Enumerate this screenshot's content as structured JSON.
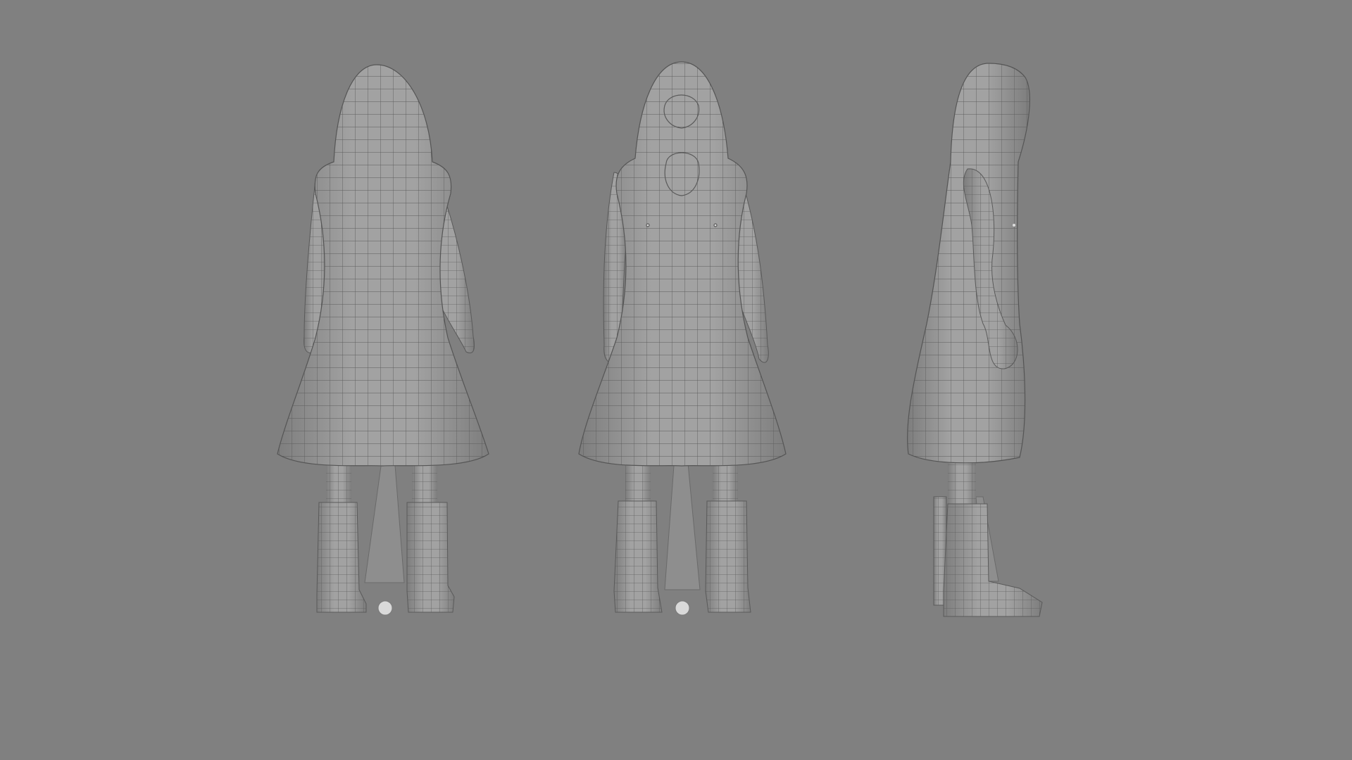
{
  "scene": {
    "background_color": "#808080",
    "mesh_color": "#9a9a9a",
    "wire_color": "#5e5e5e",
    "views": [
      {
        "name": "back",
        "icon": "character-back-view"
      },
      {
        "name": "front",
        "icon": "character-front-view"
      },
      {
        "name": "side",
        "icon": "character-side-view"
      }
    ]
  }
}
